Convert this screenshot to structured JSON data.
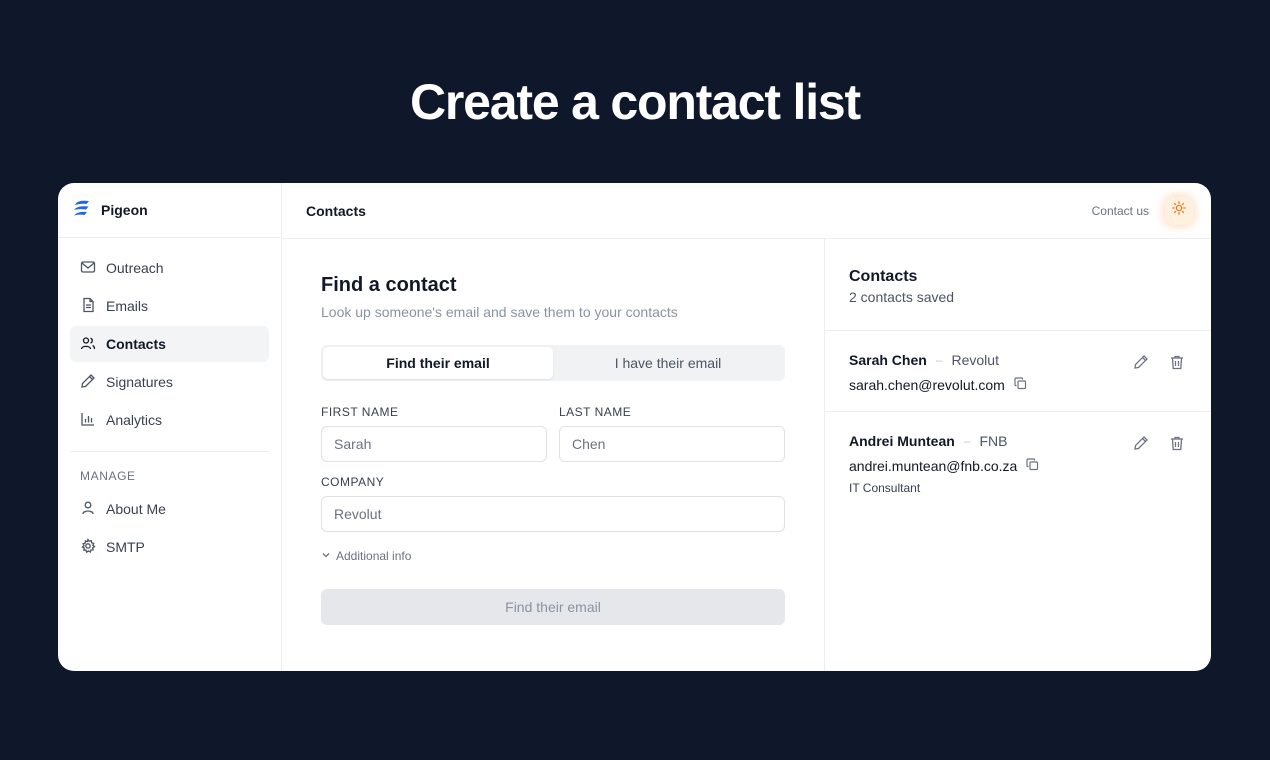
{
  "hero": {
    "title": "Create a contact list"
  },
  "brand": {
    "name": "Pigeon",
    "accent": "#2563eb"
  },
  "sidebar": {
    "items": [
      {
        "label": "Outreach",
        "icon": "mail-icon"
      },
      {
        "label": "Emails",
        "icon": "document-icon"
      },
      {
        "label": "Contacts",
        "icon": "users-icon",
        "active": true
      },
      {
        "label": "Signatures",
        "icon": "pen-icon"
      },
      {
        "label": "Analytics",
        "icon": "bar-chart-icon"
      }
    ],
    "manage_label": "MANAGE",
    "manage_items": [
      {
        "label": "About Me",
        "icon": "user-icon"
      },
      {
        "label": "SMTP",
        "icon": "gear-icon"
      }
    ]
  },
  "topbar": {
    "title": "Contacts",
    "contact_link": "Contact us",
    "theme_icon": "sun-icon",
    "theme_color": "#f97316"
  },
  "finder": {
    "title": "Find a contact",
    "subtitle": "Look up someone's email and save them to your contacts",
    "tabs": [
      "Find their email",
      "I have their email"
    ],
    "active_tab": 0,
    "first_name": {
      "label": "FIRST NAME",
      "placeholder": "Sarah",
      "value": ""
    },
    "last_name": {
      "label": "LAST NAME",
      "placeholder": "Chen",
      "value": ""
    },
    "company": {
      "label": "COMPANY",
      "placeholder": "Revolut",
      "value": ""
    },
    "additional_info": "Additional info",
    "submit_label": "Find their email"
  },
  "contacts": {
    "title": "Contacts",
    "count_text": "2 contacts saved",
    "separator": "–",
    "items": [
      {
        "name": "Sarah Chen",
        "company": "Revolut",
        "email": "sarah.chen@revolut.com",
        "job_title": ""
      },
      {
        "name": "Andrei Muntean",
        "company": "FNB",
        "email": "andrei.muntean@fnb.co.za",
        "job_title": "IT Consultant"
      }
    ]
  }
}
